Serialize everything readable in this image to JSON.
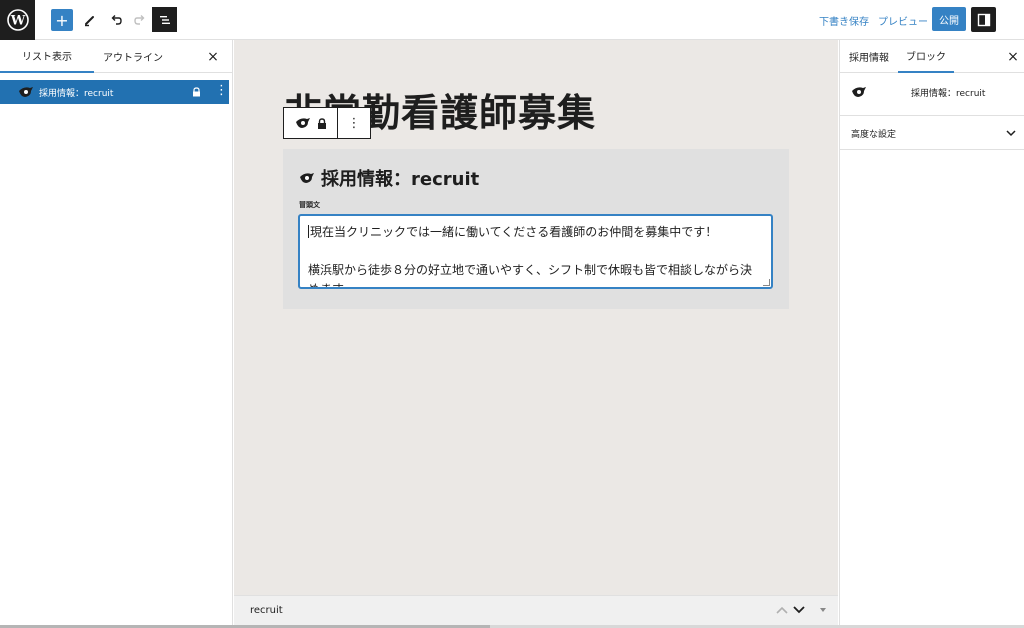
{
  "topbar": {
    "save_draft": "下書き保存",
    "preview": "プレビュー",
    "publish": "公開",
    "icons": [
      "wordpress-icon",
      "plus-icon",
      "pencil-icon",
      "undo-icon",
      "redo-icon",
      "document-overview-icon",
      "settings-panel-icon"
    ]
  },
  "left_panel": {
    "tabs": [
      {
        "label": "リスト表示",
        "active": true
      },
      {
        "label": "アウトライン",
        "active": false
      }
    ],
    "list_item": {
      "label": "採用情報：recruit",
      "selected": true
    }
  },
  "canvas": {
    "page_title": "非常勤看護師募集",
    "block": {
      "heading": "採用情報：recruit",
      "field_label": "冒頭文",
      "text_line1": "現在当クリニックでは一緒に働いてくださる看護師のお仲間を募集中です！",
      "text_line2": "横浜駅から徒歩８分の好立地で通いやすく、シフト制で休暇も皆で相談しながら決",
      "text_line3": "めます。"
    }
  },
  "footer": {
    "breadcrumb": "recruit"
  },
  "right_panel": {
    "tabs": [
      {
        "label": "採用情報",
        "active": false
      },
      {
        "label": "ブロック",
        "active": true
      }
    ],
    "block_name": "採用情報：recruit",
    "advanced_label": "高度な設定"
  },
  "colors": {
    "accent": "#3582c4",
    "selected_row": "#2271b1",
    "canvas_bg": "#ebe8e5",
    "dark": "#1e1e1e"
  }
}
